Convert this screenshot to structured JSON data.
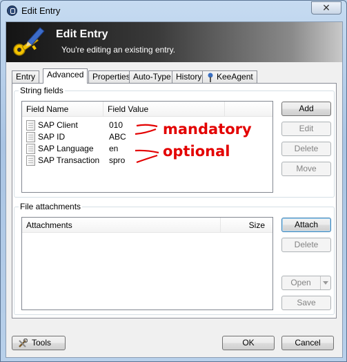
{
  "window": {
    "title": "Edit Entry",
    "close_glyph": "✕"
  },
  "banner": {
    "title": "Edit Entry",
    "subtitle": "You're editing an existing entry."
  },
  "tabs": [
    {
      "label": "Entry",
      "active": false
    },
    {
      "label": "Advanced",
      "active": true
    },
    {
      "label": "Properties",
      "active": false
    },
    {
      "label": "Auto-Type",
      "active": false
    },
    {
      "label": "History",
      "active": false
    },
    {
      "label": "KeeAgent",
      "active": false
    }
  ],
  "string_fields": {
    "group_label": "String fields",
    "columns": [
      "Field Name",
      "Field Value"
    ],
    "rows": [
      {
        "name": "SAP Client",
        "value": "010"
      },
      {
        "name": "SAP ID",
        "value": "ABC"
      },
      {
        "name": "SAP Language",
        "value": "en"
      },
      {
        "name": "SAP Transaction",
        "value": "spro"
      }
    ],
    "buttons": {
      "add": "Add",
      "edit": "Edit",
      "delete": "Delete",
      "move": "Move"
    }
  },
  "annotations": {
    "mandatory": "mandatory",
    "optional": "optional",
    "color": "#e30000"
  },
  "file_attachments": {
    "group_label": "File attachments",
    "columns": [
      "Attachments",
      "Size"
    ],
    "buttons": {
      "attach": "Attach",
      "delete": "Delete",
      "open": "Open",
      "save": "Save"
    }
  },
  "footer": {
    "tools": "Tools",
    "ok": "OK",
    "cancel": "Cancel"
  }
}
